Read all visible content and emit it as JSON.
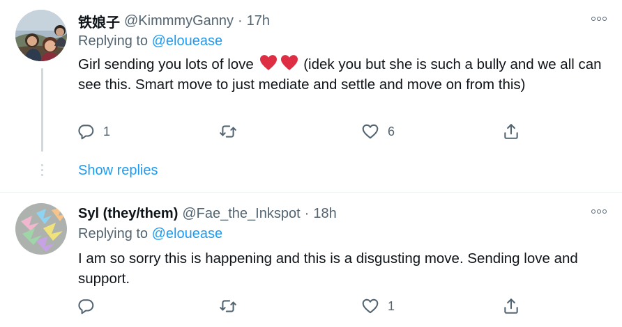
{
  "tweets": [
    {
      "author_name": "铁娘子",
      "author_handle": "@KimmmyGanny",
      "separator": "·",
      "time": "17h",
      "replying_prefix": "Replying to",
      "replying_to": "@elouease",
      "text_before_emoji": "Girl sending you lots of love",
      "emoji": "red-heart-emoji red-heart-emoji",
      "text_after_emoji": " (idek you but she is such a bully and we all can see this. Smart move to just mediate and settle and move on from this)",
      "reply_count": "1",
      "retweet_count": "",
      "like_count": "6",
      "show_replies_label": "Show replies"
    },
    {
      "author_name": "Syl (they/them)",
      "author_handle": "@Fae_the_Inkspot",
      "separator": "·",
      "time": "18h",
      "replying_prefix": "Replying to",
      "replying_to": "@elouease",
      "text": "I am so sorry this is happening and this is a disgusting move. Sending love and support.",
      "reply_count": "",
      "retweet_count": "",
      "like_count": "1"
    }
  ],
  "colors": {
    "accent": "#1d9bf0",
    "secondary_text": "#536471",
    "divider": "#eff3f4",
    "heart": "#e0245e"
  }
}
